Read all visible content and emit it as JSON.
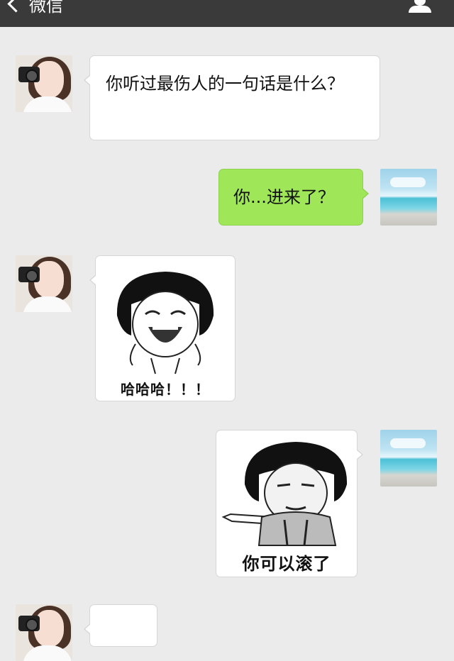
{
  "topbar": {
    "back_label": "微信",
    "background": "#3a3a3a"
  },
  "messages": [
    {
      "side": "left",
      "avatar": "girl-with-camera-avatar",
      "text": "你听过最伤人的一句话是什么？"
    },
    {
      "side": "right",
      "avatar": "sea-landscape-avatar",
      "text": "你...进来了？",
      "bubble_color": "#9fe658"
    },
    {
      "side": "left",
      "avatar": "girl-with-camera-avatar",
      "sticker": "laughing-bowl-cut-face",
      "caption": "哈哈哈！！！"
    },
    {
      "side": "right",
      "avatar": "sea-landscape-avatar",
      "sticker": "pointing-bowl-cut-face",
      "caption": "你可以滚了"
    },
    {
      "side": "left",
      "avatar": "girl-with-camera-avatar",
      "text": ""
    }
  ]
}
